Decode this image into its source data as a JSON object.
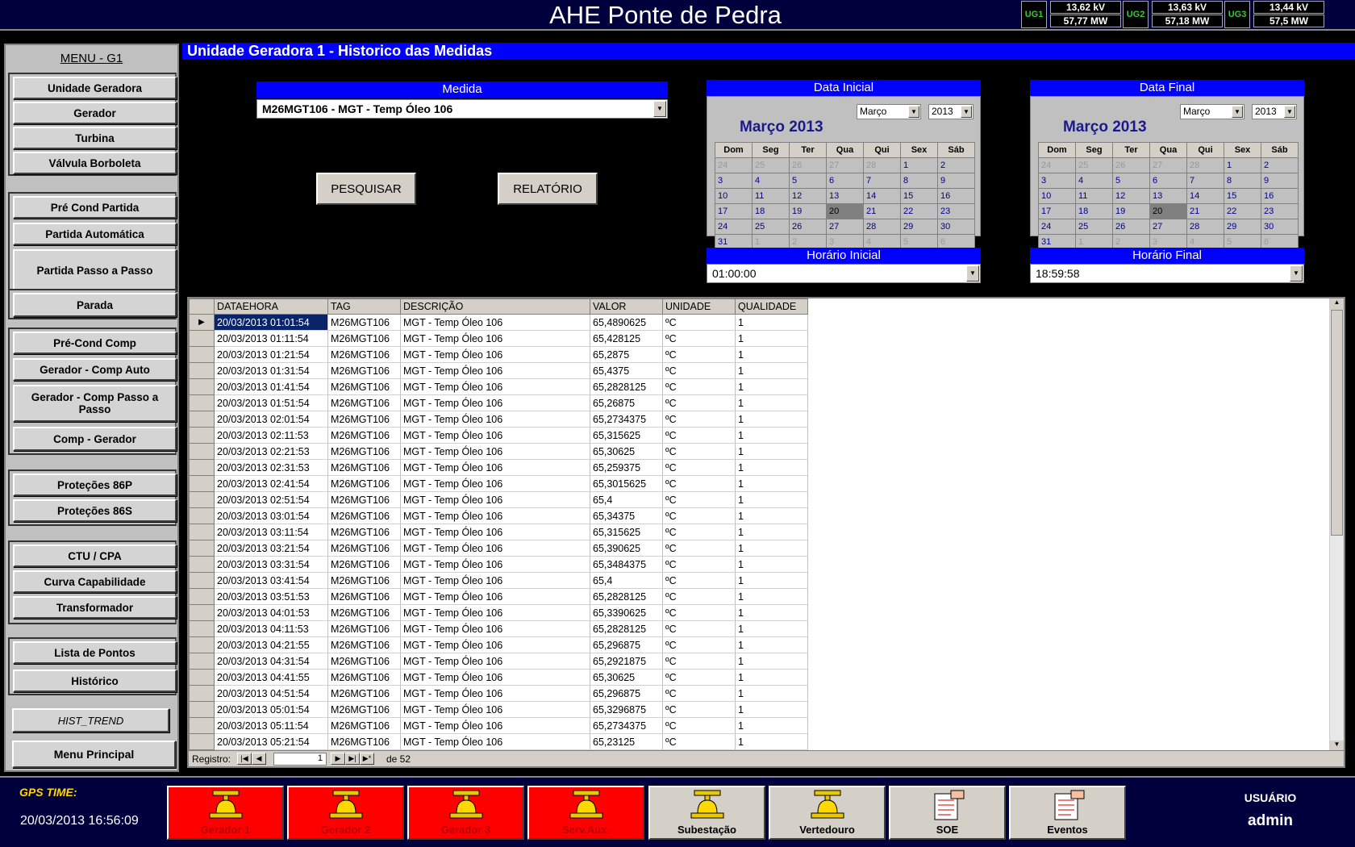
{
  "header": {
    "title": "AHE Ponte de Pedra",
    "units": [
      {
        "label": "UG1",
        "kv": "13,62  kV",
        "mw": "57,77  MW"
      },
      {
        "label": "UG2",
        "kv": "13,63  kV",
        "mw": "57,18  MW"
      },
      {
        "label": "UG3",
        "kv": "13,44  kV",
        "mw": "57,5  MW"
      }
    ]
  },
  "menu": {
    "title": "MENU - G1",
    "items": [
      "Unidade Geradora",
      "Gerador",
      "Turbina",
      "Válvula Borboleta",
      "Pré Cond Partida",
      "Partida Automática",
      "Partida Passo a Passo",
      "Parada",
      "Pré-Cond Comp",
      "Gerador - Comp Auto",
      "Gerador - Comp Passo a Passo",
      "Comp - Gerador",
      "Proteções 86P",
      "Proteções 86S",
      "CTU / CPA",
      "Curva Capabilidade",
      "Transformador",
      "Lista de Pontos",
      "Histórico",
      "HIST_TREND",
      "Menu Principal"
    ]
  },
  "main": {
    "title": "Unidade Geradora 1 - Historico das Medidas",
    "medida_label": "Medida",
    "medida_value": "M26MGT106 - MGT - Temp Óleo 106",
    "search_label": "PESQUISAR",
    "report_label": "RELATÓRIO",
    "data_inicial": {
      "label": "Data Inicial",
      "month_title": "Março 2013",
      "month": "Março",
      "year": "2013"
    },
    "data_final": {
      "label": "Data Final",
      "month_title": "Março 2013",
      "month": "Março",
      "year": "2013"
    },
    "weekdays": [
      "Dom",
      "Seg",
      "Ter",
      "Qua",
      "Qui",
      "Sex",
      "Sáb"
    ],
    "calendar_days": [
      [
        "24",
        "25",
        "26",
        "27",
        "28",
        "1",
        "2"
      ],
      [
        "3",
        "4",
        "5",
        "6",
        "7",
        "8",
        "9"
      ],
      [
        "10",
        "11",
        "12",
        "13",
        "14",
        "15",
        "16"
      ],
      [
        "17",
        "18",
        "19",
        "20",
        "21",
        "22",
        "23"
      ],
      [
        "24",
        "25",
        "26",
        "27",
        "28",
        "29",
        "30"
      ],
      [
        "31",
        "1",
        "2",
        "3",
        "4",
        "5",
        "6"
      ]
    ],
    "selected_day": "20",
    "horario_inicial": {
      "label": "Horário Inicial",
      "value": "01:00:00"
    },
    "horario_final": {
      "label": "Horário Final",
      "value": "18:59:58"
    }
  },
  "grid": {
    "columns": [
      "DATAEHORA",
      "TAG",
      "DESCRIÇÃO",
      "VALOR",
      "UNIDADE",
      "QUALIDADE"
    ],
    "rows": [
      [
        "20/03/2013 01:01:54",
        "M26MGT106",
        "MGT - Temp Óleo 106",
        "65,4890625",
        "ºC",
        "1"
      ],
      [
        "20/03/2013 01:11:54",
        "M26MGT106",
        "MGT - Temp Óleo 106",
        "65,428125",
        "ºC",
        "1"
      ],
      [
        "20/03/2013 01:21:54",
        "M26MGT106",
        "MGT - Temp Óleo 106",
        "65,2875",
        "ºC",
        "1"
      ],
      [
        "20/03/2013 01:31:54",
        "M26MGT106",
        "MGT - Temp Óleo 106",
        "65,4375",
        "ºC",
        "1"
      ],
      [
        "20/03/2013 01:41:54",
        "M26MGT106",
        "MGT - Temp Óleo 106",
        "65,2828125",
        "ºC",
        "1"
      ],
      [
        "20/03/2013 01:51:54",
        "M26MGT106",
        "MGT - Temp Óleo 106",
        "65,26875",
        "ºC",
        "1"
      ],
      [
        "20/03/2013 02:01:54",
        "M26MGT106",
        "MGT - Temp Óleo 106",
        "65,2734375",
        "ºC",
        "1"
      ],
      [
        "20/03/2013 02:11:53",
        "M26MGT106",
        "MGT - Temp Óleo 106",
        "65,315625",
        "ºC",
        "1"
      ],
      [
        "20/03/2013 02:21:53",
        "M26MGT106",
        "MGT - Temp Óleo 106",
        "65,30625",
        "ºC",
        "1"
      ],
      [
        "20/03/2013 02:31:53",
        "M26MGT106",
        "MGT - Temp Óleo 106",
        "65,259375",
        "ºC",
        "1"
      ],
      [
        "20/03/2013 02:41:54",
        "M26MGT106",
        "MGT - Temp Óleo 106",
        "65,3015625",
        "ºC",
        "1"
      ],
      [
        "20/03/2013 02:51:54",
        "M26MGT106",
        "MGT - Temp Óleo 106",
        "65,4",
        "ºC",
        "1"
      ],
      [
        "20/03/2013 03:01:54",
        "M26MGT106",
        "MGT - Temp Óleo 106",
        "65,34375",
        "ºC",
        "1"
      ],
      [
        "20/03/2013 03:11:54",
        "M26MGT106",
        "MGT - Temp Óleo 106",
        "65,315625",
        "ºC",
        "1"
      ],
      [
        "20/03/2013 03:21:54",
        "M26MGT106",
        "MGT - Temp Óleo 106",
        "65,390625",
        "ºC",
        "1"
      ],
      [
        "20/03/2013 03:31:54",
        "M26MGT106",
        "MGT - Temp Óleo 106",
        "65,3484375",
        "ºC",
        "1"
      ],
      [
        "20/03/2013 03:41:54",
        "M26MGT106",
        "MGT - Temp Óleo 106",
        "65,4",
        "ºC",
        "1"
      ],
      [
        "20/03/2013 03:51:53",
        "M26MGT106",
        "MGT - Temp Óleo 106",
        "65,2828125",
        "ºC",
        "1"
      ],
      [
        "20/03/2013 04:01:53",
        "M26MGT106",
        "MGT - Temp Óleo 106",
        "65,3390625",
        "ºC",
        "1"
      ],
      [
        "20/03/2013 04:11:53",
        "M26MGT106",
        "MGT - Temp Óleo 106",
        "65,2828125",
        "ºC",
        "1"
      ],
      [
        "20/03/2013 04:21:55",
        "M26MGT106",
        "MGT - Temp Óleo 106",
        "65,296875",
        "ºC",
        "1"
      ],
      [
        "20/03/2013 04:31:54",
        "M26MGT106",
        "MGT - Temp Óleo 106",
        "65,2921875",
        "ºC",
        "1"
      ],
      [
        "20/03/2013 04:41:55",
        "M26MGT106",
        "MGT - Temp Óleo 106",
        "65,30625",
        "ºC",
        "1"
      ],
      [
        "20/03/2013 04:51:54",
        "M26MGT106",
        "MGT - Temp Óleo 106",
        "65,296875",
        "ºC",
        "1"
      ],
      [
        "20/03/2013 05:01:54",
        "M26MGT106",
        "MGT - Temp Óleo 106",
        "65,3296875",
        "ºC",
        "1"
      ],
      [
        "20/03/2013 05:11:54",
        "M26MGT106",
        "MGT - Temp Óleo 106",
        "65,2734375",
        "ºC",
        "1"
      ],
      [
        "20/03/2013 05:21:54",
        "M26MGT106",
        "MGT - Temp Óleo 106",
        "65,23125",
        "ºC",
        "1"
      ]
    ],
    "nav": {
      "label": "Registro:",
      "current": "1",
      "total_text": "de 52"
    }
  },
  "footer": {
    "gps_label": "GPS TIME:",
    "gps_value": "20/03/2013 16:56:09",
    "buttons": [
      {
        "label": "Gerador 1",
        "state": "alarm",
        "icon": "bell-icon"
      },
      {
        "label": "Gerador 2",
        "state": "alarm",
        "icon": "bell-icon"
      },
      {
        "label": "Gerador 3",
        "state": "alarm",
        "icon": "bell-icon"
      },
      {
        "label": "Serv.Aux.",
        "state": "alarm",
        "icon": "bell-icon"
      },
      {
        "label": "Subestação",
        "state": "normal",
        "icon": "bell-icon"
      },
      {
        "label": "Vertedouro",
        "state": "normal",
        "icon": "bell-icon"
      },
      {
        "label": "SOE",
        "state": "normal",
        "icon": "document-icon"
      },
      {
        "label": "Eventos",
        "state": "normal",
        "icon": "document-icon"
      }
    ],
    "user_label": "USUÁRIO",
    "user_value": "admin"
  },
  "colors": {
    "alarm": "#ff0000",
    "title_bar": "#0000ff",
    "header_bg": "#00003c"
  }
}
